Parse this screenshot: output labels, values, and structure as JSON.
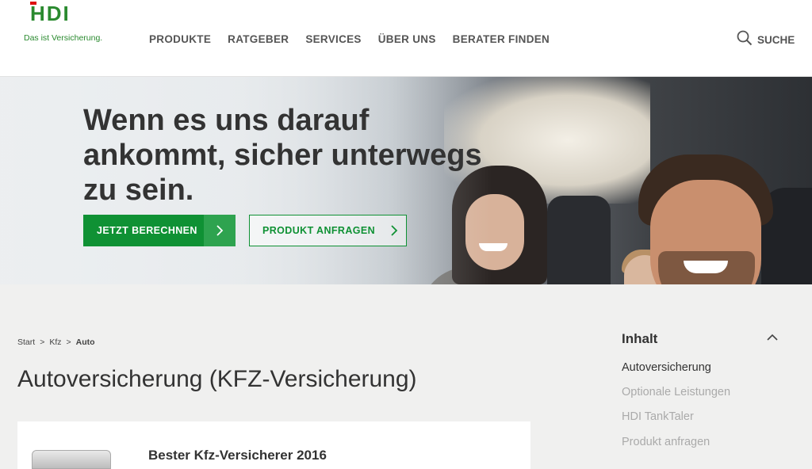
{
  "header": {
    "logo_text": "HDI",
    "logo_tagline": "Das ist Versicherung.",
    "nav": [
      "PRODUKTE",
      "RATGEBER",
      "SERVICES",
      "ÜBER UNS",
      "BERATER FINDEN"
    ],
    "search_label": "SUCHE"
  },
  "hero": {
    "title": "Wenn es uns darauf ankommt, sicher unterwegs zu sein.",
    "primary_button": "JETZT BERECHNEN",
    "secondary_button": "PRODUKT ANFRAGEN"
  },
  "breadcrumb": [
    "Start",
    "Kfz",
    "Auto"
  ],
  "page_title": "Autoversicherung (KFZ-Versicherung)",
  "card": {
    "title": "Bester Kfz-Versicherer 2016"
  },
  "toc": {
    "title": "Inhalt",
    "items": [
      "Autoversicherung",
      "Optionale Leistungen",
      "HDI TankTaler",
      "Produkt anfragen"
    ]
  },
  "colors": {
    "brand_green": "#0f9134",
    "logo_red": "#dd1111"
  }
}
